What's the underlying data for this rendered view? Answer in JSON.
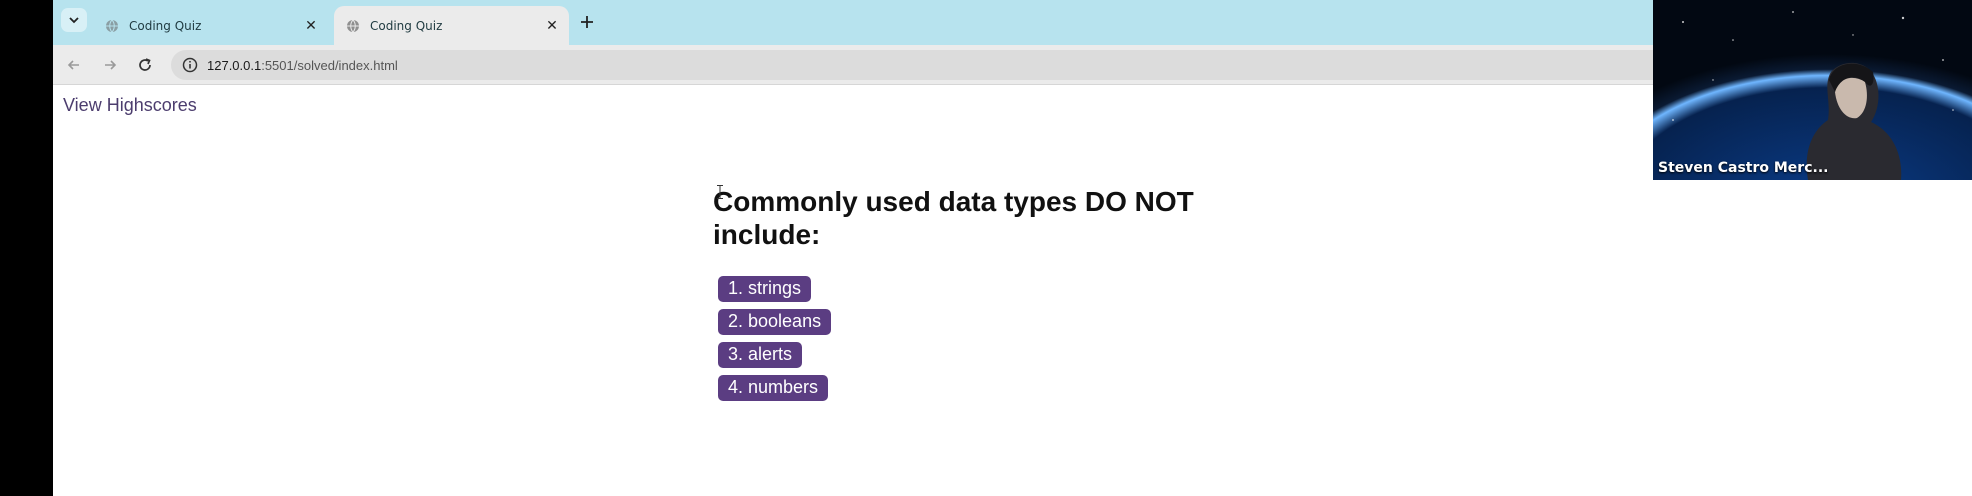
{
  "browser": {
    "tabs": [
      {
        "title": "Coding Quiz",
        "active": false
      },
      {
        "title": "Coding Quiz",
        "active": true
      }
    ],
    "address": {
      "host": "127.0.0.1",
      "path": ":5501/solved/index.html"
    },
    "icons": {
      "tab_search": "chevron-down-icon",
      "favicon": "globe-icon",
      "close": "close-icon",
      "new_tab": "plus-icon",
      "back": "arrow-left-icon",
      "forward": "arrow-right-icon",
      "reload": "reload-icon",
      "site_info": "info-icon"
    }
  },
  "page": {
    "highscores_link": "View Highscores",
    "question": "Commonly used data types DO NOT include:",
    "choices": [
      "1. strings",
      "2. booleans",
      "3. alerts",
      "4. numbers"
    ],
    "colors": {
      "accent": "#5b3d82",
      "link": "#4c3d6e",
      "tabstrip": "#b7e3ee"
    }
  },
  "webcam": {
    "participant_name": "Steven Castro Merc..."
  }
}
